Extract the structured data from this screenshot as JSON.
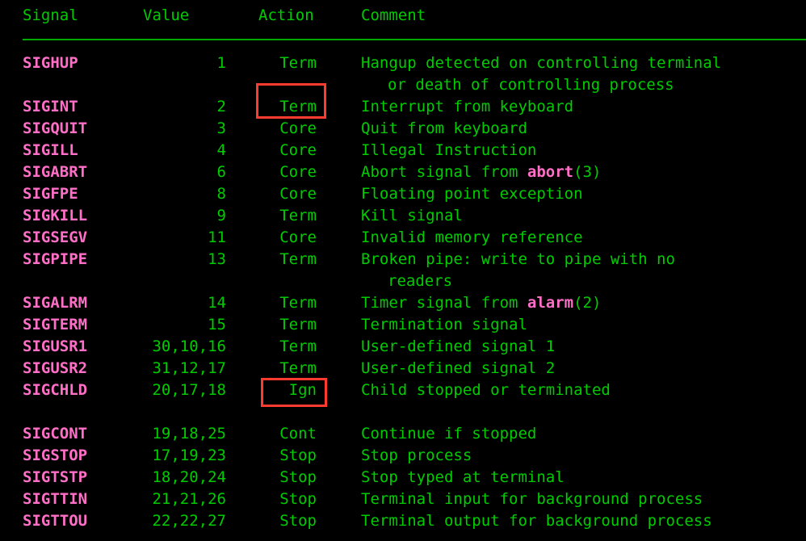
{
  "colors": {
    "background": "#000000",
    "text_green": "#00cc00",
    "signal_pink": "#ff6ec7",
    "rule_green": "#00aa00",
    "highlight_red": "#ff3b30"
  },
  "table": {
    "headers": {
      "signal": "Signal",
      "value": "Value",
      "action": "Action",
      "comment": "Comment"
    },
    "groups": [
      {
        "rows": [
          {
            "signal": "SIGHUP",
            "value": "1",
            "action": "Term",
            "comment": "Hangup detected on controlling terminal",
            "comment_cont": "or death of controlling process"
          },
          {
            "signal": "SIGINT",
            "value": "2",
            "action": "Term",
            "comment": "Interrupt from keyboard",
            "highlighted": "action"
          },
          {
            "signal": "SIGQUIT",
            "value": "3",
            "action": "Core",
            "comment": "Quit from keyboard"
          },
          {
            "signal": "SIGILL",
            "value": "4",
            "action": "Core",
            "comment": "Illegal Instruction"
          },
          {
            "signal": "SIGABRT",
            "value": "6",
            "action": "Core",
            "comment_pre": "Abort signal from ",
            "comment_ref": "abort",
            "comment_post": "(3)",
            "comment": "Abort signal from abort(3)"
          },
          {
            "signal": "SIGFPE",
            "value": "8",
            "action": "Core",
            "comment": "Floating point exception"
          },
          {
            "signal": "SIGKILL",
            "value": "9",
            "action": "Term",
            "comment": "Kill signal"
          },
          {
            "signal": "SIGSEGV",
            "value": "11",
            "action": "Core",
            "comment": "Invalid memory reference"
          },
          {
            "signal": "SIGPIPE",
            "value": "13",
            "action": "Term",
            "comment": "Broken pipe: write to pipe with no",
            "comment_cont": "readers"
          },
          {
            "signal": "SIGALRM",
            "value": "14",
            "action": "Term",
            "comment_pre": "Timer signal from ",
            "comment_ref": "alarm",
            "comment_post": "(2)",
            "comment": "Timer signal from alarm(2)"
          },
          {
            "signal": "SIGTERM",
            "value": "15",
            "action": "Term",
            "comment": "Termination signal"
          },
          {
            "signal": "SIGUSR1",
            "value": "30,10,16",
            "action": "Term",
            "comment": "User-defined signal 1"
          },
          {
            "signal": "SIGUSR2",
            "value": "31,12,17",
            "action": "Term",
            "comment": "User-defined signal 2"
          },
          {
            "signal": "SIGCHLD",
            "value": "20,17,18",
            "action": "Ign",
            "comment": "Child stopped or terminated",
            "highlighted": "action"
          }
        ]
      },
      {
        "rows": [
          {
            "signal": "SIGCONT",
            "value": "19,18,25",
            "action": "Cont",
            "comment": "Continue if stopped"
          },
          {
            "signal": "SIGSTOP",
            "value": "17,19,23",
            "action": "Stop",
            "comment": "Stop process"
          },
          {
            "signal": "SIGTSTP",
            "value": "18,20,24",
            "action": "Stop",
            "comment": "Stop typed at terminal"
          },
          {
            "signal": "SIGTTIN",
            "value": "21,21,26",
            "action": "Stop",
            "comment": "Terminal input for background process"
          },
          {
            "signal": "SIGTTOU",
            "value": "22,22,27",
            "action": "Stop",
            "comment": "Terminal output for background process"
          }
        ]
      }
    ]
  },
  "annotations": [
    {
      "name": "highlight-box-term",
      "target_signal": "SIGINT",
      "target_column": "action",
      "target_text": "Term"
    },
    {
      "name": "highlight-box-ign",
      "target_signal": "SIGCHLD",
      "target_column": "action",
      "target_text": "Ign"
    }
  ]
}
